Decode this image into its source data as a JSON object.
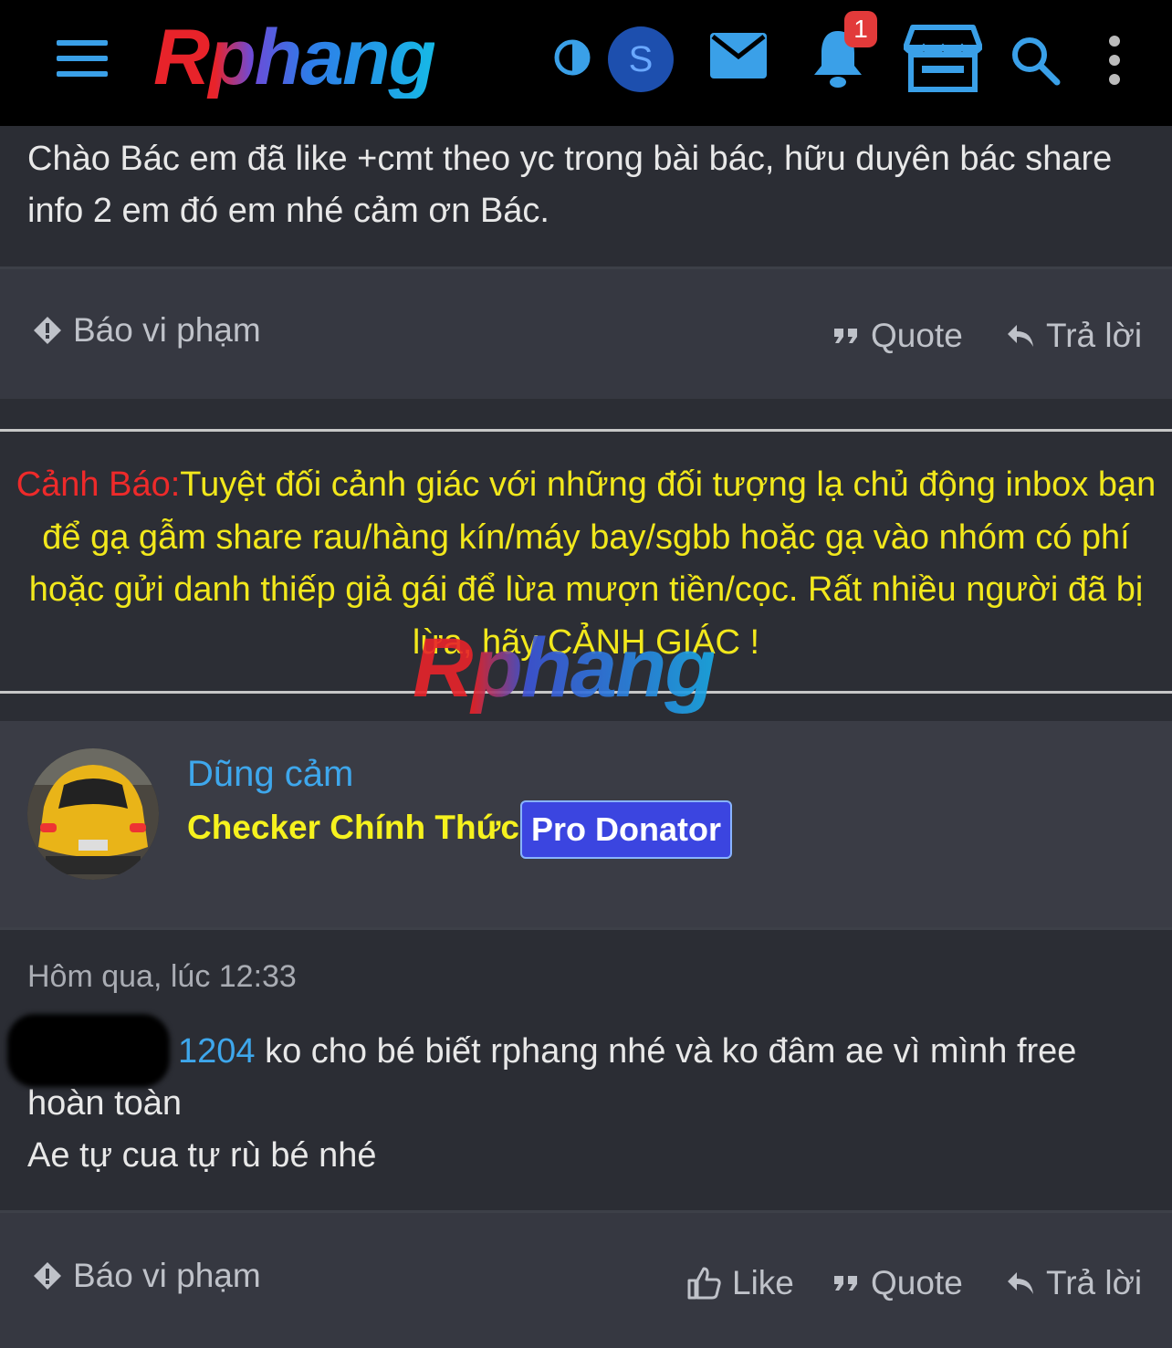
{
  "header": {
    "logo": "Rphang",
    "avatar_letter": "S",
    "notification_count": "1"
  },
  "post1": {
    "text": "Chào Bác em đã like +cmt theo yc trong bài bác, hữu duyên bác share info 2 em đó em nhé cảm ơn Bác.",
    "actions": {
      "report": "Báo vi phạm",
      "quote": "Quote",
      "reply": "Trả lời"
    }
  },
  "warning": {
    "title": "Cảnh Báo:",
    "text": "Tuyệt đối cảnh giác với những đối tượng lạ chủ động inbox bạn để gạ gẫm share rau/hàng kín/máy bay/sgbb hoặc gạ vào nhóm có phí hoặc gửi danh thiếp giả gái để lừa mượn tiền/cọc. Rất nhiều người đã bị lừa, hãy CẢNH GIÁC !",
    "watermark": "Rphang"
  },
  "user": {
    "name": "Dũng cảm",
    "title": "Checker Chính Thức",
    "badge": "Pro Donator"
  },
  "post2": {
    "timestamp": "Hôm qua, lúc 12:33",
    "mention": "1204",
    "line1": " ko cho bé biết rphang nhé và ko đâm ae vì mình free",
    "line2": "hoàn toàn",
    "line3": "Ae tự cua tự rù bé nhé",
    "actions": {
      "report": "Báo vi phạm",
      "like": "Like",
      "quote": "Quote",
      "reply": "Trả lời"
    }
  },
  "colors": {
    "accent": "#3ea7ec",
    "warning_text": "#f2e81c",
    "warning_title": "#ee2a2a",
    "user_title": "#f6f21e",
    "badge_bg": "#3b45e0"
  }
}
